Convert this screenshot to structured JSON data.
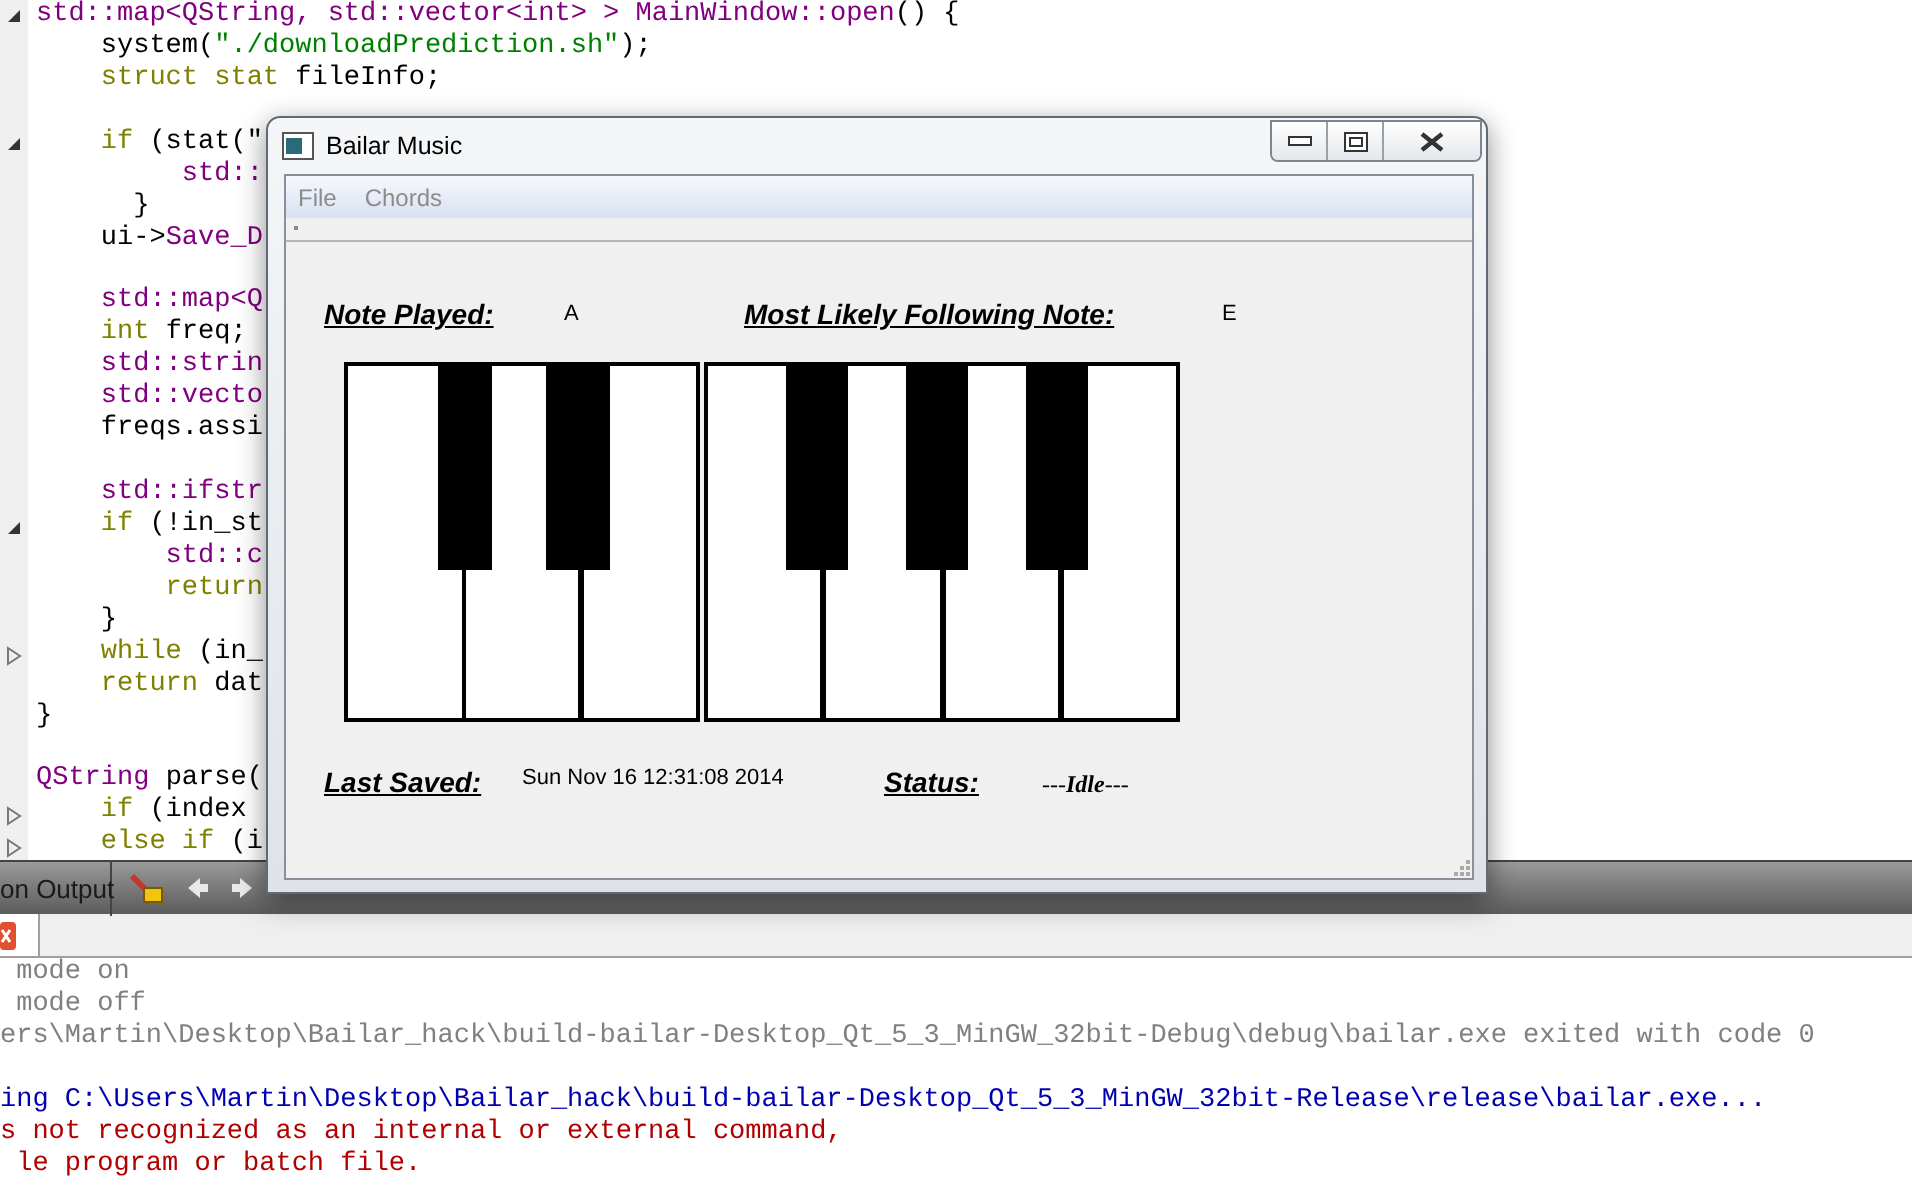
{
  "editor": {
    "lines": [
      {
        "kind": "code",
        "expanded": true,
        "tokens": [
          {
            "kind": "type",
            "text": "std::map<QString, std::vector<int> > MainWindow::open"
          },
          {
            "kind": "plain",
            "text": "() {"
          }
        ]
      },
      {
        "kind": "code",
        "tokens": [
          {
            "kind": "plain",
            "text": "    system("
          },
          {
            "kind": "string",
            "text": "\"./downloadPrediction.sh\""
          },
          {
            "kind": "plain",
            "text": ");"
          }
        ]
      },
      {
        "kind": "code",
        "tokens": [
          {
            "kind": "keyword",
            "text": "    struct stat"
          },
          {
            "kind": "plain",
            "text": " fileInfo;"
          }
        ]
      },
      {
        "kind": "blank"
      },
      {
        "kind": "code",
        "expanded": true,
        "tokens": [
          {
            "kind": "keyword",
            "text": "    if"
          },
          {
            "kind": "plain",
            "text": " (stat(\""
          }
        ]
      },
      {
        "kind": "code",
        "tokens": [
          {
            "kind": "type",
            "text": "         std::"
          }
        ]
      },
      {
        "kind": "code",
        "tokens": [
          {
            "kind": "plain",
            "text": "      }"
          }
        ]
      },
      {
        "kind": "code",
        "tokens": [
          {
            "kind": "plain",
            "text": "    ui->"
          },
          {
            "kind": "type",
            "text": "Save_D"
          }
        ]
      },
      {
        "kind": "blank"
      },
      {
        "kind": "code",
        "tokens": [
          {
            "kind": "type",
            "text": "    std::map<Q"
          }
        ]
      },
      {
        "kind": "code",
        "tokens": [
          {
            "kind": "keyword",
            "text": "    int"
          },
          {
            "kind": "plain",
            "text": " freq;"
          }
        ]
      },
      {
        "kind": "code",
        "tokens": [
          {
            "kind": "type",
            "text": "    std::strin"
          }
        ]
      },
      {
        "kind": "code",
        "tokens": [
          {
            "kind": "type",
            "text": "    std::vecto"
          }
        ]
      },
      {
        "kind": "code",
        "tokens": [
          {
            "kind": "plain",
            "text": "    freqs.assi"
          }
        ]
      },
      {
        "kind": "blank"
      },
      {
        "kind": "code",
        "tokens": [
          {
            "kind": "type",
            "text": "    std::ifstr"
          }
        ]
      },
      {
        "kind": "code",
        "expanded": true,
        "tokens": [
          {
            "kind": "keyword",
            "text": "    if"
          },
          {
            "kind": "plain",
            "text": " (!in_st"
          }
        ]
      },
      {
        "kind": "code",
        "tokens": [
          {
            "kind": "type",
            "text": "        std::c"
          }
        ]
      },
      {
        "kind": "code",
        "tokens": [
          {
            "kind": "keyword",
            "text": "        return"
          }
        ]
      },
      {
        "kind": "code",
        "tokens": [
          {
            "kind": "plain",
            "text": "    }"
          }
        ]
      },
      {
        "kind": "code",
        "expanded": false,
        "tokens": [
          {
            "kind": "keyword",
            "text": "    while"
          },
          {
            "kind": "plain",
            "text": " (in_"
          }
        ]
      },
      {
        "kind": "code",
        "tokens": [
          {
            "kind": "keyword",
            "text": "    return"
          },
          {
            "kind": "plain",
            "text": " dat"
          }
        ]
      },
      {
        "kind": "code",
        "tokens": [
          {
            "kind": "plain",
            "text": "}"
          }
        ]
      },
      {
        "kind": "blank"
      },
      {
        "kind": "code",
        "tokens": [
          {
            "kind": "type",
            "text": "QString"
          },
          {
            "kind": "plain",
            "text": " parse("
          }
        ]
      },
      {
        "kind": "code",
        "expanded": false,
        "tokens": [
          {
            "kind": "keyword",
            "text": "    if"
          },
          {
            "kind": "plain",
            "text": " (index"
          }
        ]
      },
      {
        "kind": "code",
        "expanded": false,
        "tokens": [
          {
            "kind": "keyword",
            "text": "    else if"
          },
          {
            "kind": "plain",
            "text": " (i"
          }
        ]
      }
    ]
  },
  "output_pane": {
    "title": "on Output",
    "lines": [
      {
        "kind": "info",
        "text": " mode on"
      },
      {
        "kind": "info",
        "text": " mode off"
      },
      {
        "kind": "info",
        "text": "ers\\Martin\\Desktop\\Bailar_hack\\build-bailar-Desktop_Qt_5_3_MinGW_32bit-Debug\\debug\\bailar.exe exited with code 0"
      },
      {
        "kind": "blank"
      },
      {
        "kind": "start",
        "text": "ing C:\\Users\\Martin\\Desktop\\Bailar_hack\\build-bailar-Desktop_Qt_5_3_MinGW_32bit-Release\\release\\bailar.exe..."
      },
      {
        "kind": "error",
        "text": "s not recognized as an internal or external command,"
      },
      {
        "kind": "error",
        "text": " le program or batch file."
      }
    ]
  },
  "app_window": {
    "title": "Bailar Music",
    "menu": [
      {
        "label": "File",
        "disabled": true
      },
      {
        "label": "Chords",
        "disabled": true
      }
    ],
    "note_played": {
      "label": "Note Played:",
      "value": "A"
    },
    "next_note": {
      "label": "Most Likely Following Note:",
      "value": "E"
    },
    "last_saved": {
      "label": "Last Saved:",
      "value": "Sun Nov 16 12:31:08 2014"
    },
    "status": {
      "label": "Status:",
      "value": "---**Idle**---"
    }
  }
}
